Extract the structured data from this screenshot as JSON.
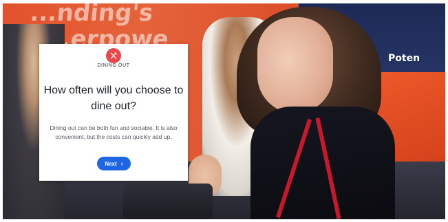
{
  "background": {
    "banner_line1": "...nding's",
    "banner_line2": "...erpowe",
    "navy_sign": "Poten"
  },
  "card": {
    "category_icon": "fork-knife-icon",
    "category_label": "DINING OUT",
    "question": "How often will you choose to dine out?",
    "description": "Dining out can be both fun and sociable. It is also convenient, but the costs can quickly add up.",
    "next_label": "Next",
    "next_icon": "chevron-right-icon",
    "accent_color": "#e8484a",
    "button_color": "#1f66e5"
  }
}
